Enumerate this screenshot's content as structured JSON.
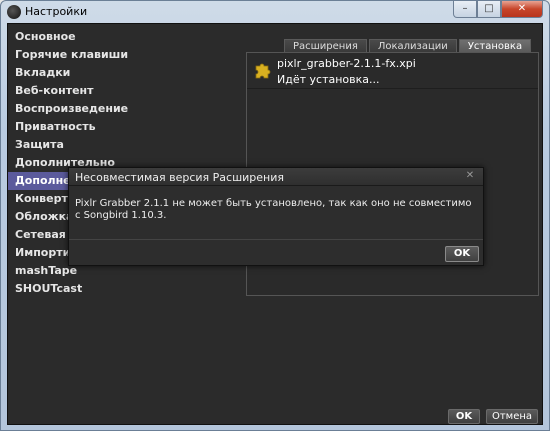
{
  "window": {
    "title": "Настройки",
    "close_glyph": "✕",
    "minimize_glyph": "–",
    "maximize_glyph": "□"
  },
  "sidebar": {
    "items": [
      {
        "label": "Основное"
      },
      {
        "label": "Горячие клавиши"
      },
      {
        "label": "Вкладки"
      },
      {
        "label": "Веб-контент"
      },
      {
        "label": "Воспроизведение"
      },
      {
        "label": "Приватность"
      },
      {
        "label": "Защита"
      },
      {
        "label": "Дополнительно"
      },
      {
        "label": "Дополнения"
      },
      {
        "label": "Конвертер"
      },
      {
        "label": "Обложка альбома"
      },
      {
        "label": "Сетевая интеграция"
      },
      {
        "label": "Импортирование"
      },
      {
        "label": "mashTape"
      },
      {
        "label": "SHOUTcast"
      }
    ],
    "selected_index": 8
  },
  "tabs": [
    {
      "label": "Расширения"
    },
    {
      "label": "Локализации"
    },
    {
      "label": "Установка"
    }
  ],
  "active_tab": 2,
  "install": {
    "name": "pixlr_grabber-2.1.1-fx.xpi",
    "status": "Идёт установка...",
    "icon": "puzzle-piece-icon"
  },
  "buttons": {
    "ok": "OK",
    "cancel": "Отмена"
  },
  "dialog": {
    "title": "Несовместимая версия Расширения",
    "close_glyph": "✕",
    "message": "Pixlr Grabber 2.1.1 не может быть установлено, так как оно не совместимо с Songbird 1.10.3.",
    "ok": "OK"
  },
  "colors": {
    "background": "#2b2b2b",
    "selected": "#5b5a9c",
    "icon": "#d8b020"
  }
}
